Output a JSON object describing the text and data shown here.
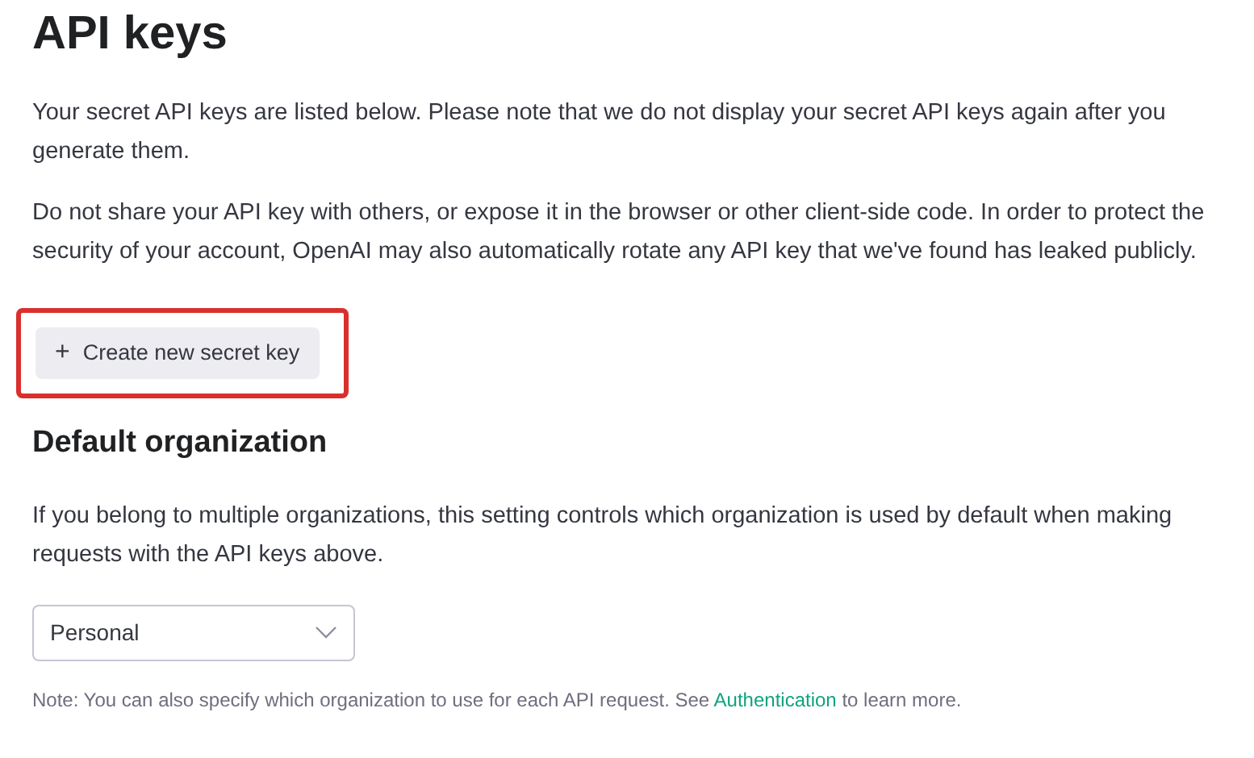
{
  "title": "API keys",
  "paragraphs": [
    "Your secret API keys are listed below. Please note that we do not display your secret API keys again after you generate them.",
    "Do not share your API key with others, or expose it in the browser or other client-side code. In order to protect the security of your account, OpenAI may also automatically rotate any API key that we've found has leaked publicly."
  ],
  "create_button": {
    "icon": "+",
    "label": "Create new secret key",
    "highlighted": true
  },
  "default_organization": {
    "heading": "Default organization",
    "description": "If you belong to multiple organizations, this setting controls which organization is used by default when making requests with the API keys above.",
    "select": {
      "value": "Personal"
    },
    "note": {
      "text": "Note: You can also specify which organization to use for each API request. See",
      "link": "Authentication",
      "after": "to learn more."
    }
  }
}
